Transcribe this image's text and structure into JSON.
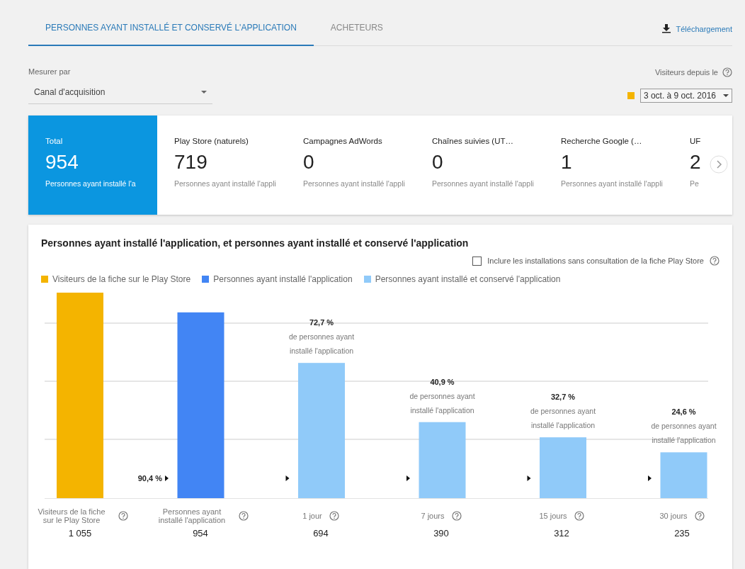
{
  "tabs": [
    {
      "label": "PERSONNES AYANT INSTALLÉ ET CONSERVÉ L'APPLICATION",
      "selected": true
    },
    {
      "label": "ACHETEURS",
      "selected": false
    }
  ],
  "download": {
    "label": "Téléchargement"
  },
  "measure": {
    "label": "Mesurer par",
    "value": "Canal d'acquisition"
  },
  "date_filter": {
    "label": "Visiteurs depuis le",
    "color": "#f4b400",
    "value": "3 oct. à 9 oct. 2016"
  },
  "summary": {
    "total": {
      "title": "Total",
      "value": "954",
      "description": "Personnes ayant installé l'a"
    },
    "channels": [
      {
        "title": "Play Store (naturels)",
        "value": "719",
        "description": "Personnes ayant installé l'appli"
      },
      {
        "title": "Campagnes AdWords",
        "value": "0",
        "description": "Personnes ayant installé l'appli"
      },
      {
        "title": "Chaînes suivies (UT…",
        "value": "0",
        "description": "Personnes ayant installé l'appli"
      },
      {
        "title": "Recherche Google (…",
        "value": "1",
        "description": "Personnes ayant installé l'appli"
      },
      {
        "title": "UF",
        "value": "2",
        "description": "Pe"
      }
    ]
  },
  "funnel": {
    "title": "Personnes ayant installé l'application, et personnes ayant installé et conservé l'application",
    "checkbox": {
      "label": "Inclure les installations sans consultation de la fiche Play Store",
      "checked": false
    },
    "legend": [
      {
        "label": "Visiteurs de la fiche sur le Play Store",
        "color": "#f4b400"
      },
      {
        "label": "Personnes ayant installé l'application",
        "color": "#4285f4"
      },
      {
        "label": "Personnes ayant installé et conservé l'application",
        "color": "#90caf9"
      }
    ],
    "steps": [
      {
        "label": "Visiteurs de la fiche sur le Play Store",
        "value": "1 055",
        "level": 1,
        "color": "#f4b400",
        "conversion_rate": "90,4 %"
      },
      {
        "label": "Personnes ayant installé l'application",
        "value": "954",
        "level": 0.904,
        "color": "#4285f4"
      },
      {
        "label": "1 jour",
        "value": "694",
        "level": 0.658,
        "color": "#90caf9",
        "rate": "72,7 %",
        "caption": [
          "de personnes ayant",
          "installé l'application"
        ]
      },
      {
        "label": "7 jours",
        "value": "390",
        "level": 0.37,
        "color": "#90caf9",
        "rate": "40,9 %",
        "caption": [
          "de personnes ayant",
          "installé l'application"
        ]
      },
      {
        "label": "15 jours",
        "value": "312",
        "level": 0.296,
        "color": "#90caf9",
        "rate": "32,7 %",
        "caption": [
          "de personnes ayant",
          "installé l'application"
        ]
      },
      {
        "label": "30 jours",
        "value": "235",
        "level": 0.223,
        "color": "#90caf9",
        "rate": "24,6 %",
        "caption": [
          "de personnes ayant",
          "installé l'application"
        ]
      }
    ]
  }
}
